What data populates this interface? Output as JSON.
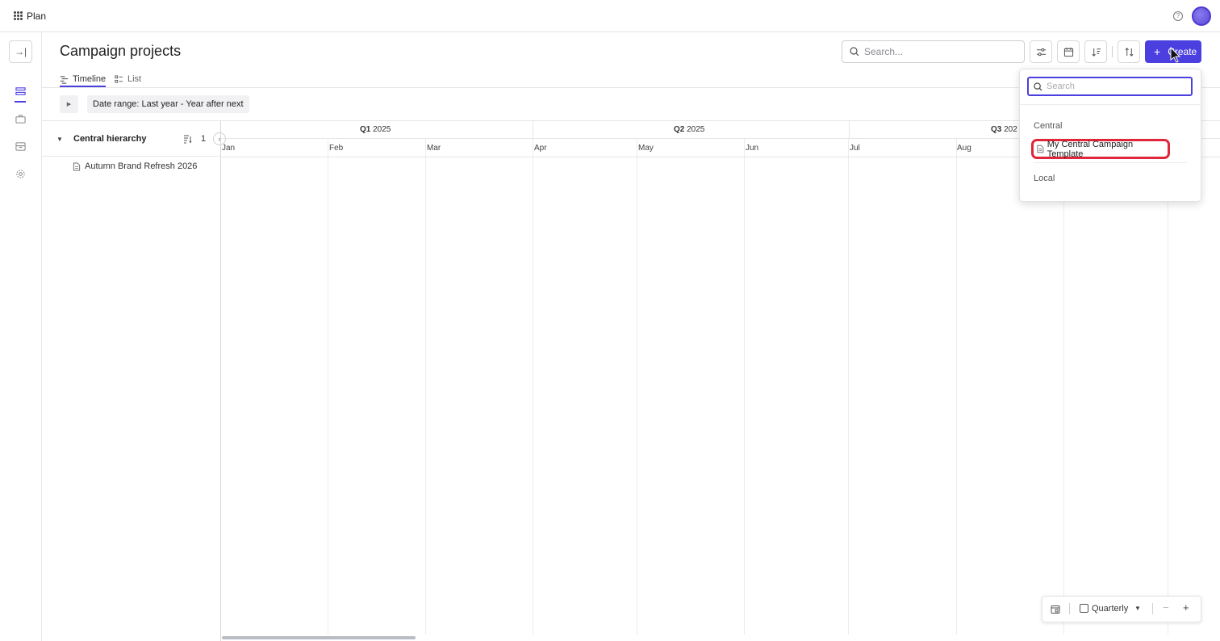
{
  "app": {
    "name": "Plan"
  },
  "header": {
    "title": "Campaign projects",
    "search_placeholder": "Search...",
    "create_label": "Create"
  },
  "tabs": [
    {
      "label": "Timeline",
      "active": true
    },
    {
      "label": "List",
      "active": false
    }
  ],
  "filters": {
    "date_range": "Date range: Last year - Year after next"
  },
  "hierarchy": {
    "title": "Central hierarchy",
    "count": "1",
    "items": [
      {
        "label": "Autumn Brand Refresh 2026"
      }
    ]
  },
  "timeline": {
    "quarters": [
      {
        "q": "Q1",
        "year": "2025"
      },
      {
        "q": "Q2",
        "year": "2025"
      },
      {
        "q": "Q3",
        "year": "202"
      }
    ],
    "months": [
      "Jan",
      "Feb",
      "Mar",
      "Apr",
      "May",
      "Jun",
      "Jul",
      "Aug"
    ]
  },
  "zoom": {
    "label": "Quarterly"
  },
  "dropdown": {
    "search_placeholder": "Search",
    "groups": [
      {
        "label": "Central",
        "items": [
          {
            "label": "My Central Campaign Template",
            "highlighted": true
          }
        ]
      },
      {
        "label": "Local",
        "items": []
      }
    ]
  },
  "colors": {
    "accent": "#4b3fe0",
    "highlight": "#e0263a"
  }
}
